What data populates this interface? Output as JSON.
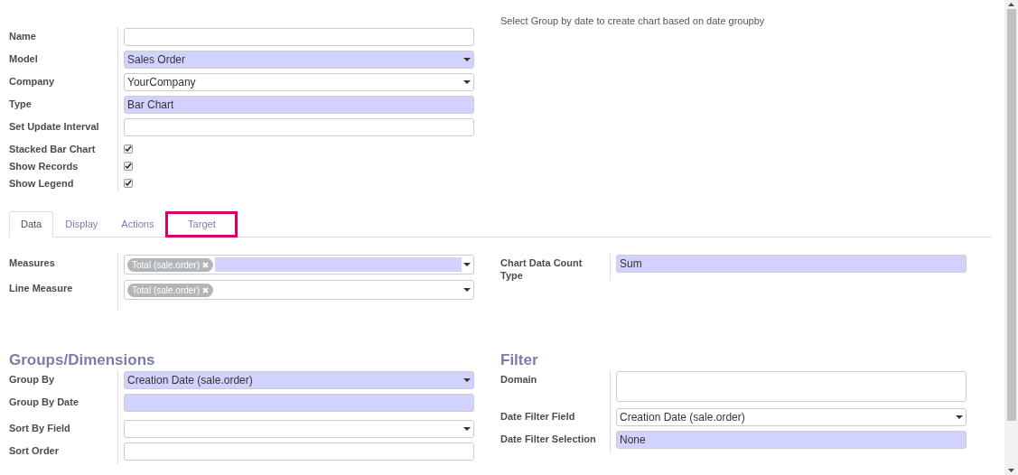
{
  "top_form": {
    "fields": [
      {
        "label": "Name",
        "kind": "text",
        "required": false
      },
      {
        "label": "Model",
        "kind": "select",
        "value": "Sales Order",
        "required": true
      },
      {
        "label": "Company",
        "kind": "select",
        "value": "YourCompany",
        "required": false
      },
      {
        "label": "Type",
        "kind": "text",
        "value": "Bar Chart",
        "required": true
      },
      {
        "label": "Set Update Interval",
        "kind": "text",
        "required": false
      },
      {
        "label": "Stacked Bar Chart",
        "kind": "checkbox",
        "checked": true
      },
      {
        "label": "Show Records",
        "kind": "checkbox",
        "checked": true
      },
      {
        "label": "Show Legend",
        "kind": "checkbox",
        "checked": true
      }
    ],
    "note": "Select Group by date to create chart based on date groupby"
  },
  "tabs": [
    {
      "label": "Data",
      "selected": true,
      "highlighted": false
    },
    {
      "label": "Display",
      "selected": false,
      "highlighted": false
    },
    {
      "label": "Actions",
      "selected": false,
      "highlighted": false
    },
    {
      "label": "Target",
      "selected": false,
      "highlighted": true
    }
  ],
  "data_tab": {
    "left": [
      {
        "label": "Measures",
        "kind": "tags",
        "tags": [
          "Total (sale.order)"
        ],
        "required": true
      },
      {
        "label": "Line Measure",
        "kind": "tags",
        "tags": [
          "Total (sale.order)"
        ],
        "required": false
      }
    ],
    "right": [
      {
        "label": "Chart Data Count Type",
        "kind": "text",
        "value": "Sum",
        "required": true
      }
    ]
  },
  "groups": {
    "title": "Groups/Dimensions",
    "fields": [
      {
        "label": "Group By",
        "kind": "select",
        "value": "Creation Date (sale.order)",
        "required": true
      },
      {
        "label": "Group By Date",
        "kind": "text",
        "required": true
      },
      {
        "label": "Sort By Field",
        "kind": "select",
        "required": false
      },
      {
        "label": "Sort Order",
        "kind": "text",
        "required": false
      }
    ]
  },
  "filter": {
    "title": "Filter",
    "fields": [
      {
        "label": "Domain",
        "kind": "textarea",
        "required": false
      },
      {
        "label": "Date Filter Field",
        "kind": "select",
        "value": "Creation Date (sale.order)",
        "required": false
      },
      {
        "label": "Date Filter Selection",
        "kind": "text",
        "value": "None",
        "required": true
      }
    ]
  }
}
